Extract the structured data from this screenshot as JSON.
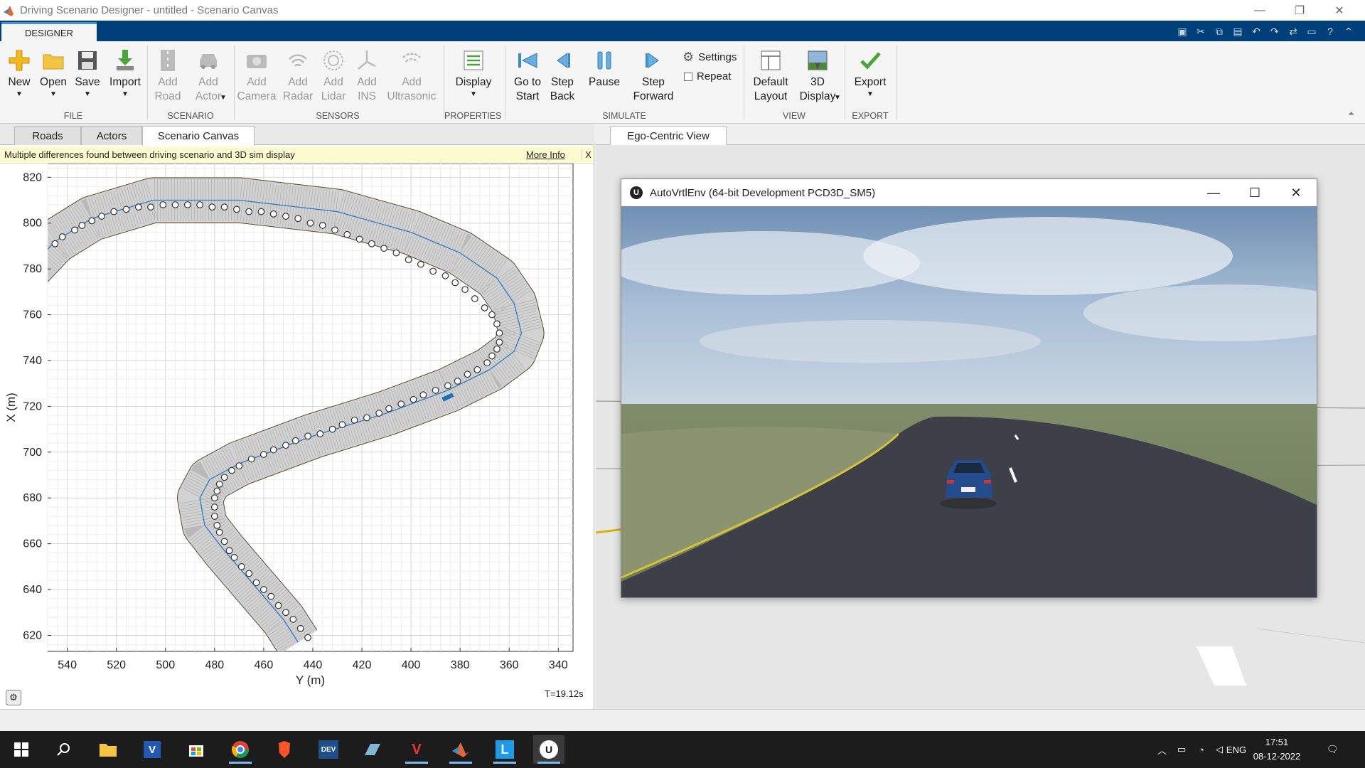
{
  "window": {
    "title": "Driving Scenario Designer - untitled - Scenario Canvas"
  },
  "ribbon": {
    "tab": "DESIGNER",
    "file": {
      "new": "New",
      "open": "Open",
      "save": "Save",
      "import": "Import",
      "label": "FILE"
    },
    "scenario": {
      "add_road": [
        "Add",
        "Road"
      ],
      "add_actor": [
        "Add",
        "Actor"
      ],
      "label": "SCENARIO"
    },
    "sensors": {
      "camera": [
        "Add",
        "Camera"
      ],
      "radar": [
        "Add",
        "Radar"
      ],
      "lidar": [
        "Add",
        "Lidar"
      ],
      "ins": [
        "Add",
        "INS"
      ],
      "ultrasonic": [
        "Add",
        "Ultrasonic"
      ],
      "label": "SENSORS"
    },
    "properties": {
      "display": "Display",
      "label": "PROPERTIES"
    },
    "simulate": {
      "go_to_start": [
        "Go to",
        "Start"
      ],
      "step_back": [
        "Step",
        "Back"
      ],
      "pause": "Pause",
      "step_forward": [
        "Step",
        "Forward"
      ],
      "settings": "Settings",
      "repeat": "Repeat",
      "label": "SIMULATE"
    },
    "view": {
      "default_layout": [
        "Default",
        "Layout"
      ],
      "display3d": [
        "3D",
        "Display"
      ],
      "label": "VIEW"
    },
    "export": {
      "export": "Export",
      "label": "EXPORT"
    }
  },
  "left": {
    "tabs": [
      "Roads",
      "Actors",
      "Scenario Canvas"
    ],
    "warning": "Multiple differences found between driving scenario and 3D sim display",
    "more_info": "More Info",
    "close": "X",
    "time": "T=19.12s"
  },
  "right": {
    "tab": "Ego-Centric View",
    "sim_window_title": "AutoVrtlEnv (64-bit Development PCD3D_SM5)"
  },
  "chart_data": {
    "type": "scatter",
    "title": "",
    "xlabel": "Y (m)",
    "ylabel": "X (m)",
    "xlim": [
      548,
      334
    ],
    "ylim": [
      613,
      826
    ],
    "x_reversed": true,
    "xticks": [
      540,
      520,
      500,
      480,
      460,
      440,
      420,
      400,
      380,
      360,
      340
    ],
    "yticks": [
      620,
      640,
      660,
      680,
      700,
      720,
      740,
      760,
      780,
      800,
      820
    ],
    "grid": true,
    "road_centerline": [
      [
        560,
        775
      ],
      [
        545,
        792
      ],
      [
        530,
        802
      ],
      [
        505,
        810
      ],
      [
        470,
        810
      ],
      [
        430,
        805
      ],
      [
        400,
        796
      ],
      [
        380,
        787
      ],
      [
        365,
        776
      ],
      [
        358,
        765
      ],
      [
        355,
        752
      ],
      [
        358,
        744
      ],
      [
        368,
        736
      ],
      [
        385,
        727
      ],
      [
        410,
        717
      ],
      [
        440,
        707
      ],
      [
        470,
        695
      ],
      [
        482,
        688
      ],
      [
        486,
        680
      ],
      [
        484,
        668
      ],
      [
        476,
        657
      ],
      [
        464,
        642
      ],
      [
        452,
        627
      ],
      [
        446,
        617
      ]
    ],
    "road_width_m": 18,
    "ego_vehicle": {
      "x": 724,
      "y": 385,
      "heading_deg": 25
    },
    "waypoints": [
      [
        545,
        791
      ],
      [
        542,
        794
      ],
      [
        537,
        797
      ],
      [
        534,
        799
      ],
      [
        530,
        801
      ],
      [
        526,
        803
      ],
      [
        521,
        805
      ],
      [
        516,
        806
      ],
      [
        511,
        807
      ],
      [
        506,
        807
      ],
      [
        501,
        808
      ],
      [
        496,
        808
      ],
      [
        491,
        808
      ],
      [
        486,
        808
      ],
      [
        481,
        807
      ],
      [
        476,
        807
      ],
      [
        471,
        806
      ],
      [
        466,
        805
      ],
      [
        461,
        805
      ],
      [
        456,
        804
      ],
      [
        451,
        803
      ],
      [
        446,
        802
      ],
      [
        441,
        800
      ],
      [
        436,
        799
      ],
      [
        431,
        797
      ],
      [
        426,
        795
      ],
      [
        421,
        793
      ],
      [
        416,
        791
      ],
      [
        411,
        789
      ],
      [
        406,
        787
      ],
      [
        401,
        784
      ],
      [
        396,
        782
      ],
      [
        391,
        779
      ],
      [
        386,
        777
      ],
      [
        382,
        774
      ],
      [
        378,
        771
      ],
      [
        374,
        767
      ],
      [
        370,
        763
      ],
      [
        367,
        760
      ],
      [
        365,
        756
      ],
      [
        364,
        752
      ],
      [
        364,
        748
      ],
      [
        365,
        745
      ],
      [
        367,
        742
      ],
      [
        369,
        739
      ],
      [
        373,
        736
      ],
      [
        377,
        734
      ],
      [
        381,
        731
      ],
      [
        385,
        729
      ],
      [
        390,
        727
      ],
      [
        395,
        725
      ],
      [
        399,
        723
      ],
      [
        404,
        721
      ],
      [
        409,
        719
      ],
      [
        413,
        717
      ],
      [
        418,
        715
      ],
      [
        423,
        714
      ],
      [
        428,
        712
      ],
      [
        432,
        710
      ],
      [
        437,
        708
      ],
      [
        442,
        707
      ],
      [
        447,
        705
      ],
      [
        451,
        703
      ],
      [
        456,
        701
      ],
      [
        460,
        699
      ],
      [
        465,
        697
      ],
      [
        470,
        694
      ],
      [
        473,
        692
      ],
      [
        476,
        689
      ],
      [
        478,
        686
      ],
      [
        479,
        683
      ],
      [
        480,
        680
      ],
      [
        480,
        676
      ],
      [
        480,
        672
      ],
      [
        479,
        668
      ],
      [
        478,
        665
      ],
      [
        476,
        661
      ],
      [
        474,
        657
      ],
      [
        472,
        654
      ],
      [
        469,
        650
      ],
      [
        466,
        647
      ],
      [
        463,
        643
      ],
      [
        460,
        640
      ],
      [
        457,
        637
      ],
      [
        454,
        633
      ],
      [
        451,
        630
      ],
      [
        448,
        627
      ],
      [
        445,
        623
      ],
      [
        442,
        619
      ]
    ]
  },
  "taskbar": {
    "lang": "ENG",
    "time": "17:51",
    "date": "08-12-2022"
  }
}
